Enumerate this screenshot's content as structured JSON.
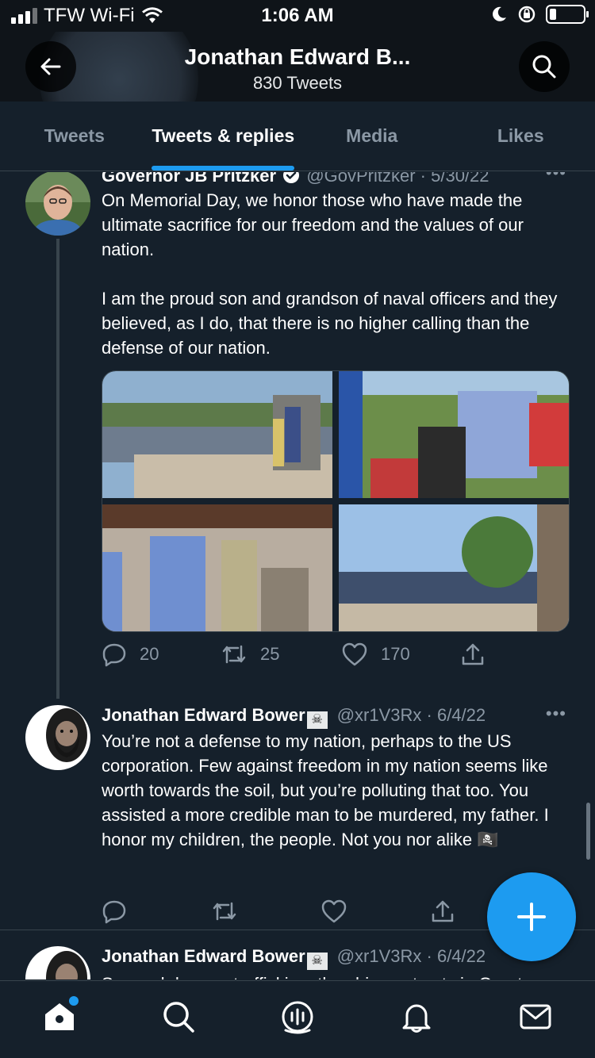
{
  "status_bar": {
    "carrier": "TFW Wi-Fi",
    "time": "1:06 AM"
  },
  "header": {
    "title": "Jonathan Edward B...",
    "subtitle": "830 Tweets"
  },
  "tabs": [
    {
      "label": "Tweets",
      "active": false
    },
    {
      "label": "Tweets & replies",
      "active": true
    },
    {
      "label": "Media",
      "active": false
    },
    {
      "label": "Likes",
      "active": false
    }
  ],
  "tweets": [
    {
      "author": "Governor JB Pritzker",
      "verified": true,
      "handle_date": "@GovPritzker · 5/30/22",
      "text": "On Memorial Day, we honor those who have made the ultimate sacrifice for our freedom and the values of our nation.\n\nI am the proud son and grandson of naval officers and they believed, as I do, that there is no higher calling than the defense of our nation.",
      "replies": "20",
      "retweets": "25",
      "likes": "170"
    },
    {
      "author": "Jonathan Edward Bower",
      "flag": "🏴‍☠️",
      "handle_date": "@xr1V3Rx · 6/4/22",
      "text": "You’re not a defense to my nation, perhaps to the US corporation. Few against freedom in my nation seems like worth towards the soil, but you’re polluting that too. You assisted a more credible man to be murdered, my father. I honor my children, the people. Not you nor alike 🏴‍☠️"
    },
    {
      "author": "Jonathan Edward Bower",
      "flag": "🏴‍☠️",
      "handle_date": "@xr1V3Rx · 6/4/22",
      "text": "So much human trafficking, the shipment out via Great"
    }
  ],
  "icons": {
    "back": "arrow-left-icon",
    "search": "search-icon",
    "more": "more-icon",
    "reply": "reply-icon",
    "retweet": "retweet-icon",
    "like": "heart-icon",
    "share": "share-icon",
    "compose": "plus-icon",
    "nav": [
      "home-icon",
      "search-icon",
      "spaces-icon",
      "bell-icon",
      "mail-icon"
    ]
  },
  "colors": {
    "accent": "#1d9bf0",
    "background": "#15202b",
    "muted": "#8b98a5"
  }
}
